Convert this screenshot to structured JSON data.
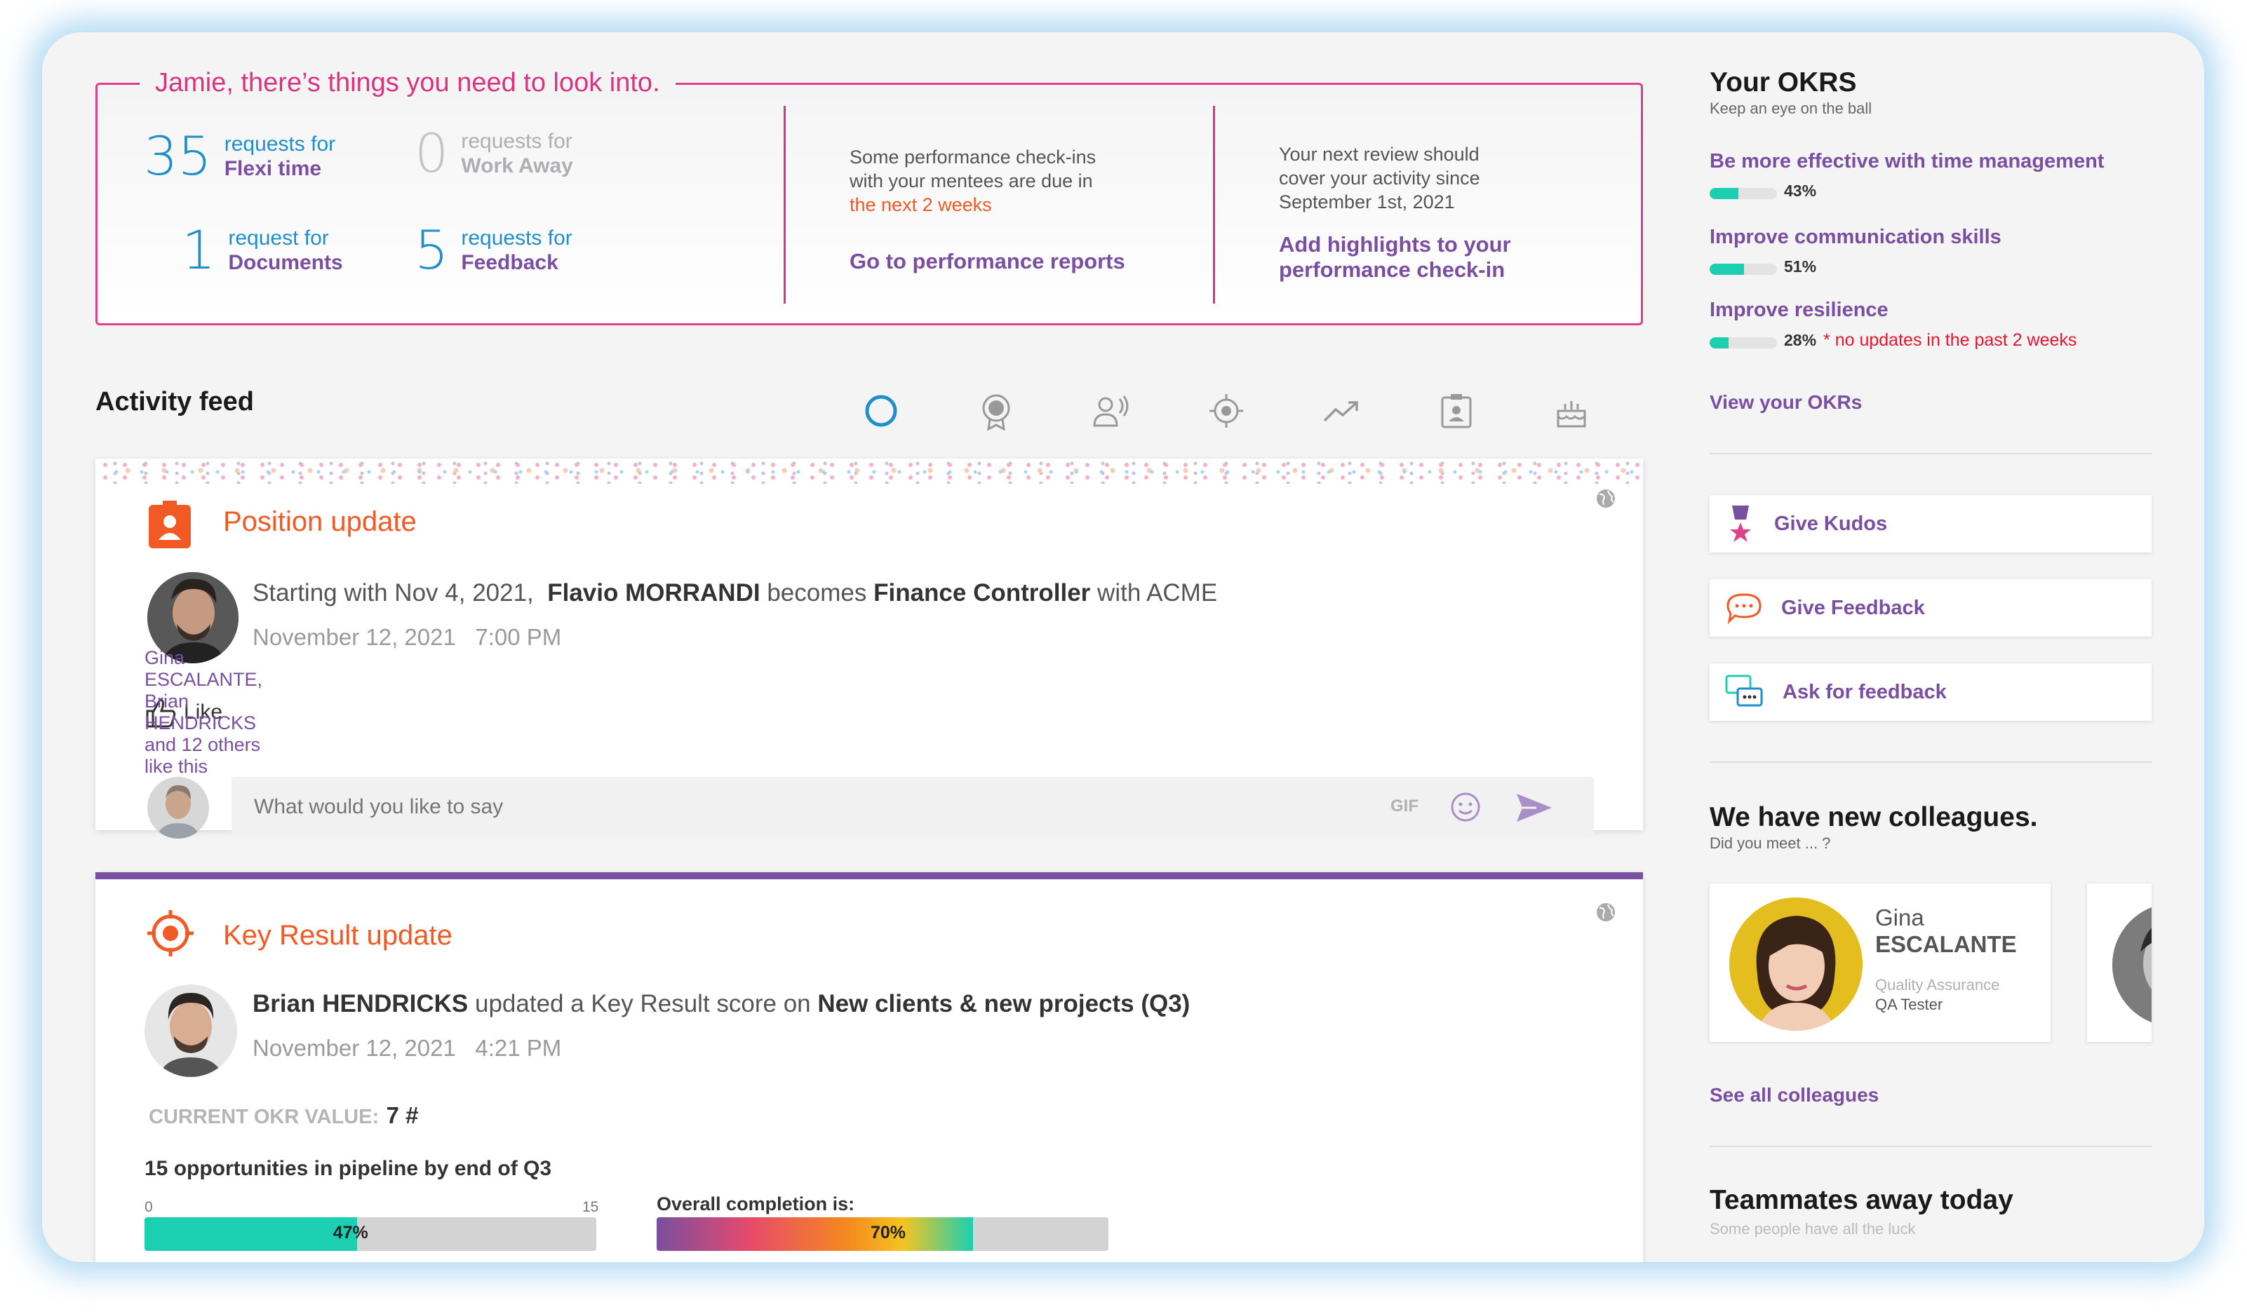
{
  "attention": {
    "title": "Jamie, there’s things you need to look into.",
    "requests": [
      {
        "count": "35",
        "line1": "requests for",
        "line2": "Flexi time"
      },
      {
        "count": "0",
        "line1": "requests for",
        "line2": "Work Away"
      },
      {
        "count": "1",
        "line1": "request for",
        "line2": "Documents"
      },
      {
        "count": "5",
        "line1": "requests for",
        "line2": "Feedback"
      }
    ],
    "checkins": {
      "line1": "Some performance check-ins",
      "line2": "with your mentees are due in",
      "highlight": "the next 2 weeks",
      "link": "Go to performance reports"
    },
    "review": {
      "line1": "Your next review should",
      "line2": "cover your activity since",
      "line3": "September 1st, 2021",
      "link1": "Add highlights to your",
      "link2": "performance check-in"
    }
  },
  "feed": {
    "title": "Activity feed",
    "filter_icons": [
      "all-circle-icon",
      "award-badge-icon",
      "announce-person-icon",
      "target-icon",
      "trend-up-icon",
      "id-badge-icon",
      "birthday-cake-icon"
    ],
    "position_card": {
      "title": "Position update",
      "statement_prefix": "Starting with Nov 4, 2021,",
      "person": "Flavio MORRANDI",
      "becomes": "becomes",
      "role": "Finance Controller",
      "with": "with ACME",
      "date": "November 12, 2021   7:00 PM",
      "like_label": "Like",
      "likes_text": "Gina ESCALANTE, Brian HENDRICKS and 12 others like this",
      "comment_placeholder": "What would you like to say",
      "gif_label": "GIF"
    },
    "kr_card": {
      "title": "Key Result update",
      "person": "Brian HENDRICKS",
      "action": "updated a Key Result score on",
      "target": "New clients & new projects (Q3)",
      "date": "November 12, 2021   4:21 PM",
      "current_label": "CURRENT OKR VALUE:",
      "current_value": "7 #",
      "kr_name": "15 opportunities in pipeline by end of Q3",
      "scale_min": "0",
      "scale_max": "15",
      "progress_label": "47%",
      "progress_value": 0.47,
      "completion_label": "Overall completion is:",
      "completion_text": "70%",
      "completion_value": 0.7
    }
  },
  "sidebar": {
    "okrs_title": "Your OKRS",
    "okrs_sub": "Keep an eye on the ball",
    "okrs": [
      {
        "label": "Be more effective with time management",
        "pct": "43%",
        "value": 0.43,
        "warning": ""
      },
      {
        "label": "Improve communication skills",
        "pct": "51%",
        "value": 0.51,
        "warning": ""
      },
      {
        "label": "Improve resilience",
        "pct": "28%",
        "value": 0.28,
        "warning": "* no updates in the past 2 weeks"
      }
    ],
    "view_okrs": "View your OKRs",
    "actions": [
      "Give Kudos",
      "Give Feedback",
      "Ask for feedback"
    ],
    "colleagues_title": "We have new colleagues.",
    "colleagues_sub": "Did you meet ... ?",
    "colleague": {
      "first": "Gina",
      "last": "ESCALANTE",
      "dept": "Quality Assurance",
      "role": "QA Tester"
    },
    "see_all": "See all colleagues",
    "away_title": "Teammates away today",
    "away_sub": "Some people have all the luck"
  },
  "colors": {
    "accent": "#7a4ea0",
    "pink": "#d9357f",
    "orange": "#f15a24",
    "blue": "#1e8fc8",
    "teal": "#1ccfb0"
  }
}
